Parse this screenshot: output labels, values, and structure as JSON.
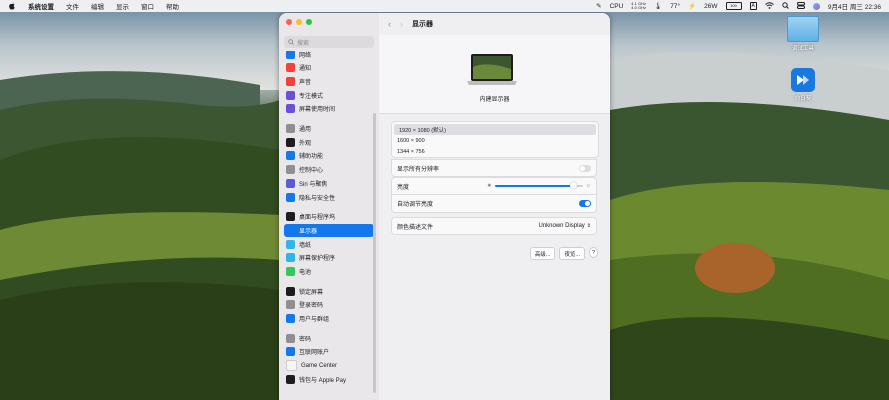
{
  "menubar": {
    "app": "系统设置",
    "menus": [
      "文件",
      "编辑",
      "显示",
      "窗口",
      "帮助"
    ],
    "cpu_label": "CPU",
    "cpu_top": "4.1 GHz",
    "cpu_bottom": "4.0 GHz",
    "temp": "77°",
    "power": "26W",
    "battery": "100",
    "input_method": "A",
    "datetime": "9月4日 周三 22:36"
  },
  "window": {
    "search_placeholder": "搜索",
    "title": "显示器",
    "monitor_name": "内建显示器",
    "resolutions": [
      "1920 × 1080 (默认)",
      "1600 × 900",
      "1344 × 756"
    ],
    "show_all_label": "显示所有分辨率",
    "brightness_label": "亮度",
    "brightness_level": 0.9,
    "auto_brightness_label": "自动调节亮度",
    "color_profile_label": "颜色描述文件",
    "color_profile_value": "Unknown Display",
    "advanced_button": "高级...",
    "night_button": "夜览...",
    "help_button": "?"
  },
  "sidebar": {
    "partial_item": "网络",
    "groups": [
      [
        {
          "label": "通知",
          "color": "#f0413a",
          "icon": "bell-icon"
        },
        {
          "label": "声音",
          "color": "#f0413a",
          "icon": "speaker-icon"
        },
        {
          "label": "专注模式",
          "color": "#6b4fd8",
          "icon": "moon-icon"
        },
        {
          "label": "屏幕使用时间",
          "color": "#6b4fd8",
          "icon": "hourglass-icon"
        }
      ],
      [
        {
          "label": "通用",
          "color": "#8e8e93",
          "icon": "gear-icon"
        },
        {
          "label": "外观",
          "color": "#1d1d1f",
          "icon": "appearance-icon"
        },
        {
          "label": "辅助功能",
          "color": "#1478ec",
          "icon": "accessibility-icon"
        },
        {
          "label": "控制中心",
          "color": "#8e8e93",
          "icon": "control-center-icon"
        },
        {
          "label": "Siri 与聚焦",
          "color": "#5b5bd6",
          "icon": "siri-icon"
        },
        {
          "label": "隐私与安全性",
          "color": "#1478ec",
          "icon": "hand-icon"
        }
      ],
      [
        {
          "label": "桌面与程序坞",
          "color": "#1d1d1f",
          "icon": "dock-icon"
        },
        {
          "label": "显示器",
          "color": "#1478ec",
          "icon": "display-icon",
          "active": true
        },
        {
          "label": "墙纸",
          "color": "#2fb5e8",
          "icon": "wallpaper-icon"
        },
        {
          "label": "屏幕保护程序",
          "color": "#2fb5e8",
          "icon": "screensaver-icon"
        },
        {
          "label": "电池",
          "color": "#34c759",
          "icon": "battery-icon"
        }
      ],
      [
        {
          "label": "锁定屏幕",
          "color": "#1d1d1f",
          "icon": "lock-icon"
        },
        {
          "label": "登录密码",
          "color": "#8e8e93",
          "icon": "key-icon"
        },
        {
          "label": "用户与群组",
          "color": "#1478ec",
          "icon": "users-icon"
        }
      ],
      [
        {
          "label": "密码",
          "color": "#8e8e93",
          "icon": "password-icon"
        },
        {
          "label": "互联网账户",
          "color": "#1478ec",
          "icon": "at-icon"
        },
        {
          "label": "Game Center",
          "color": "#f5f5f5",
          "icon": "game-center-icon"
        },
        {
          "label": "钱包与 Apple Pay",
          "color": "#1d1d1f",
          "icon": "wallet-icon"
        }
      ]
    ]
  },
  "desktop": {
    "folder_label": "调试工具",
    "app_label": "向日葵"
  }
}
